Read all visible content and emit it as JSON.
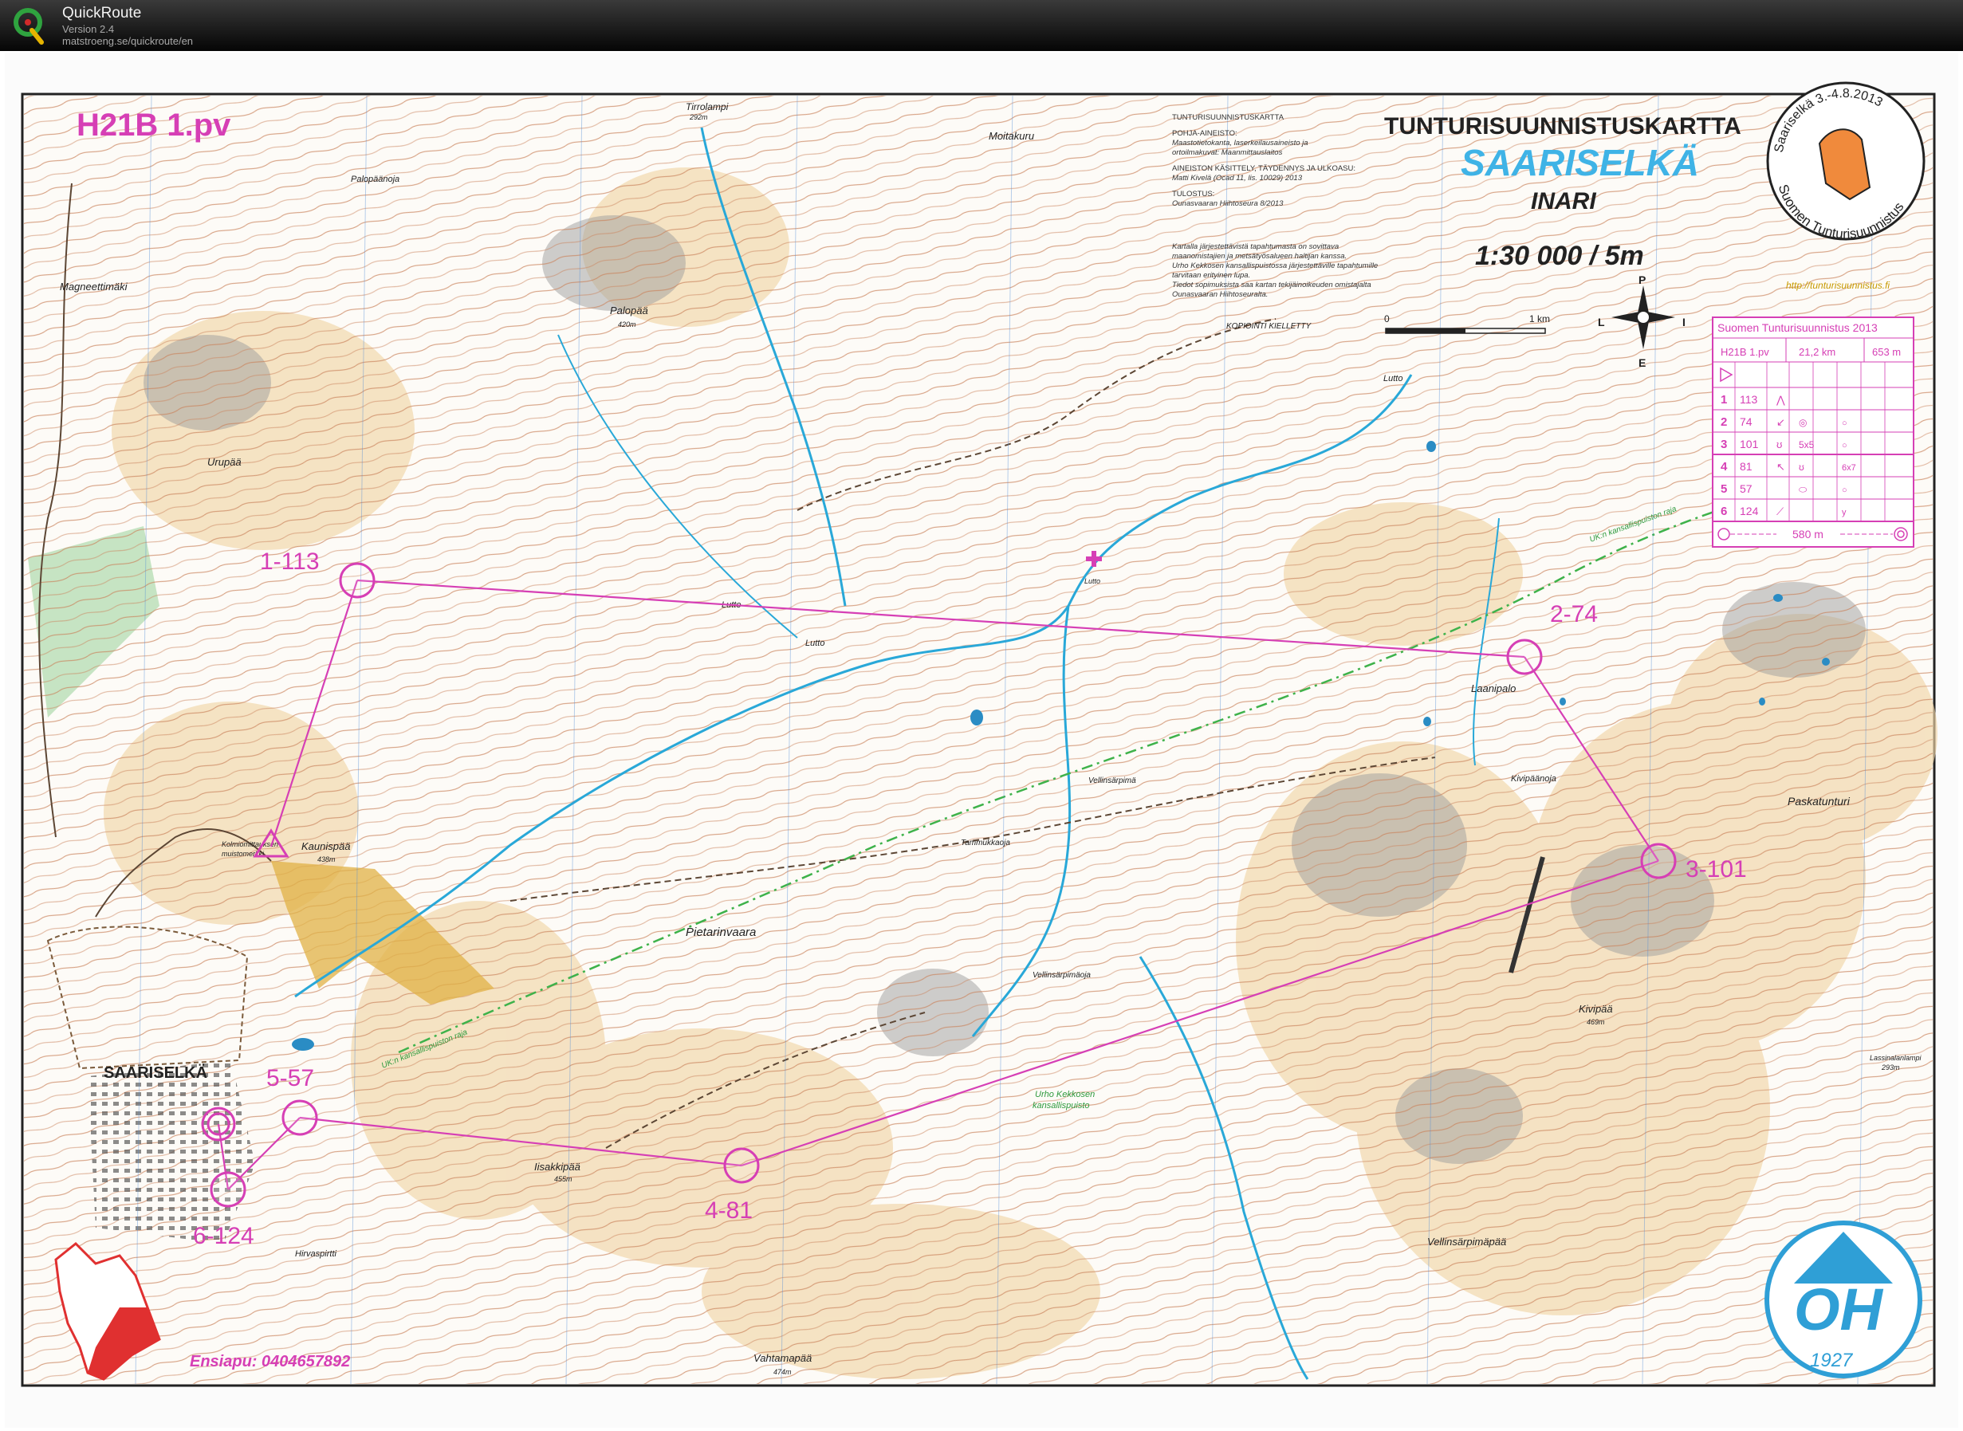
{
  "app": {
    "name": "QuickRoute",
    "version": "Version 2.4",
    "url": "matstroeng.se/quickroute/en",
    "logo_icon": "quickroute-q-logo-icon"
  },
  "map": {
    "course_title": "H21B 1.pv",
    "heading": "TUNTURISUUNNISTUSKARTTA",
    "area": "SAARISELKÄ",
    "municipality": "INARI",
    "scale": "1:30 000 / 5m",
    "url": "http://tunturisuunnistus.fi",
    "emergency": "Ensiapu: 0404657892",
    "copy_notice": "KOPIOINTI KIELLETTY",
    "scale_bar": {
      "start": "0",
      "end": "1 km"
    },
    "compass": {
      "n": "P",
      "s": "E",
      "w": "L",
      "e": "I"
    },
    "credits": [
      "TUNTURISUUNNISTUSKARTTA",
      "POHJA-AINEISTO:",
      "Maastotietokanta, laserkeilausaineisto ja",
      "ortoilmakuvat: Maanmittauslaitos",
      "AINEISTON KÄSITTELY, TÄYDENNYS JA ULKOASU:",
      "Matti Kivelä (Ocad 11, lis. 10029) 2013",
      "TULOSTUS:",
      "Ounasvaaran Hiihtoseura 8/2013",
      "Kartalla järjestettävistä tapahtumasta on sovittava",
      "maanomistajien ja metsätyösalueen haltijan kanssa.",
      "Urho Kekkosen kansallispuistossa järjestettäville tapahtumille",
      "tarvitaan erityinen lupa.",
      "Tiedot sopimuksista saa kartan tekijäinoikeuden omistajalta",
      "Ounasvaaran Hiihtoseuralta."
    ],
    "event_badge": {
      "top": "Saariselkä 3.-4.8.2013",
      "bottom": "Suomen Tunturisuunnistus"
    },
    "club_logo": {
      "letters": "OH",
      "year": "1927"
    },
    "place_names": {
      "tirrolampi": "Tirrolampi",
      "tirrolampi_h": "292m",
      "moitakuru": "Moitakuru",
      "palopaanoja": "Palopäänoja",
      "palopaa": "Palopää",
      "palopaa_h": "420m",
      "magneettimaki": "Magneettimäki",
      "urupaa": "Urupää",
      "kaunispaa": "Kaunispää",
      "kaunispaa_h": "438m",
      "kolmiomittaus": "Kolmiomittauksen",
      "muistomerkki": "muistomerkki",
      "saariselka": "SAARISELKÄ",
      "pietarinvaara": "Pietarinvaara",
      "iisakkipaa": "Iisakkipää",
      "iisakkipaa_h": "455m",
      "hirvaspirtti": "Hirvaspirtti",
      "vahtamapaa": "Vahtamapää",
      "vahtamapaa_h": "474m",
      "lutto1": "Lutto",
      "lutto2": "Lutto",
      "lutto3": "Lutto",
      "lutto4": "Lutto",
      "laanipalo": "Laanipalo",
      "kivipaanoja": "Kivipäänoja",
      "paskatunturi": "Paskatunturi",
      "kivipaa": "Kivipää",
      "kivipaa_h": "469m",
      "vellinsarpiman": "Vellinsärpimä",
      "vellinsarpimaoja": "Vellinsärpimäoja",
      "tammukkaoja": "Tammukkaoja",
      "ukk1": "Urho Kekkosen",
      "ukk2": "kansallispuisto",
      "border1": "UK:n kansallispuiston raja",
      "border2": "UK:n kansallispuiston raja",
      "vellinsarpimapaa": "Vellinsärpimäpää",
      "lassinalanlampi": "Lassinalanlampi",
      "lassinalanlampi_h": "293m"
    }
  },
  "course": {
    "controls": [
      {
        "label": "1-113"
      },
      {
        "label": "2-74"
      },
      {
        "label": "3-101"
      },
      {
        "label": "4-81"
      },
      {
        "label": "5-57"
      },
      {
        "label": "6-124"
      }
    ],
    "color": "#d63fb5"
  },
  "description_table": {
    "header": "Suomen Tunturisuunnistus 2013",
    "course": "H21B 1.pv",
    "length": "21,2 km",
    "climb": "653 m",
    "rows": [
      {
        "n": "1",
        "code": "113",
        "d1": "⋀",
        "d2": "",
        "d3": ""
      },
      {
        "n": "2",
        "code": "74",
        "d1": "↙",
        "d2": "◎",
        "d3": "○"
      },
      {
        "n": "3",
        "code": "101",
        "d1": "ʊ",
        "d2": "5x5",
        "d3": "○"
      },
      {
        "n": "4",
        "code": "81",
        "d1": "↖",
        "d2": "ʊ",
        "d3": "6x7"
      },
      {
        "n": "5",
        "code": "57",
        "d1": "",
        "d2": "⬭",
        "d3": "○"
      },
      {
        "n": "6",
        "code": "124",
        "d1": "⟋",
        "d2": "",
        "d3": "y"
      }
    ],
    "finish_distance": "580 m"
  }
}
